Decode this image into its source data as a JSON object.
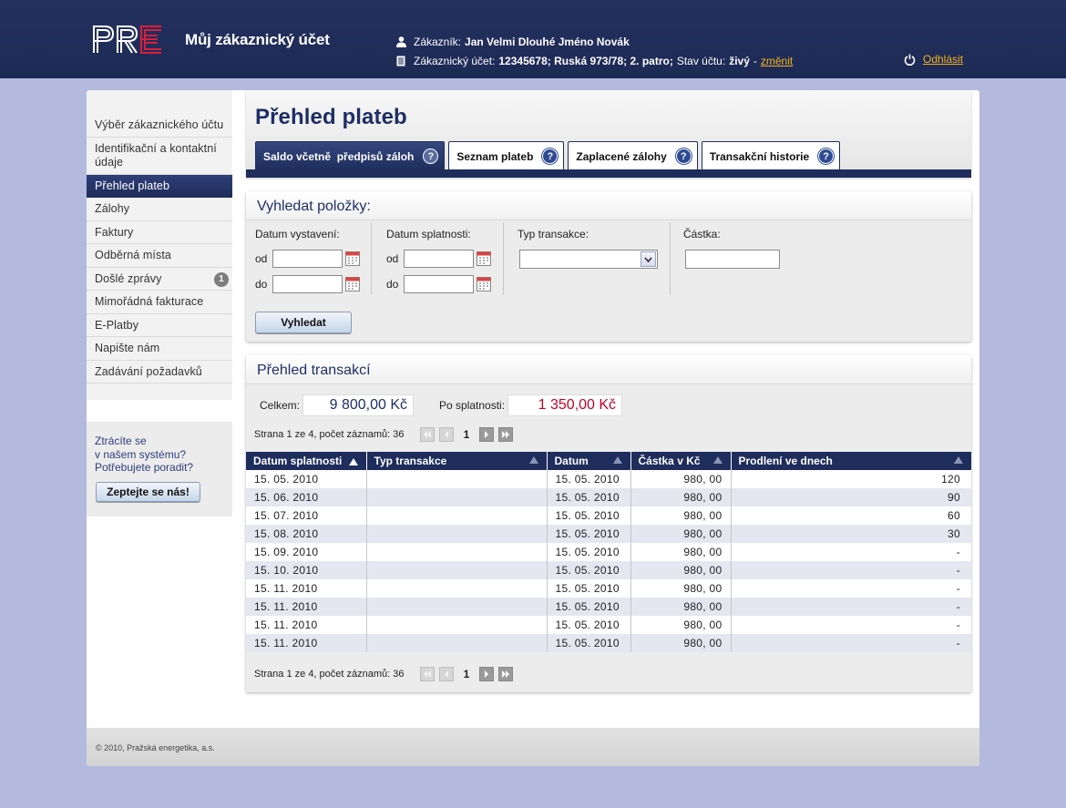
{
  "header": {
    "logo": "PRE",
    "app_title": "Můj zákaznický účet",
    "customer_label": "Zákazník:",
    "customer_name": "Jan Velmi Dlouhé Jméno Novák",
    "account_label": "Zákaznický účet:",
    "account_value": "12345678; Ruská 973/78; 2. patro;",
    "status_label": "Stav účtu:",
    "status_value": "živý",
    "status_sep": "-",
    "change_link": "změnit",
    "logout": "Odhlásit",
    "accent_color": "#f4b21c"
  },
  "sidebar": {
    "items": [
      {
        "label": "Výběr zákaznického účtu"
      },
      {
        "label": "Identifikační a kontaktní údaje"
      },
      {
        "label": "Přehled plateb",
        "active": true
      },
      {
        "label": "Zálohy"
      },
      {
        "label": "Faktury"
      },
      {
        "label": "Odběrná místa"
      },
      {
        "label": "Došlé zprávy",
        "badge": "1"
      },
      {
        "label": "Mimořádná fakturace"
      },
      {
        "label": "E-Platby"
      },
      {
        "label": "Napište nám"
      },
      {
        "label": "Zadávání požadavků"
      }
    ],
    "help_line1": "Ztrácíte se",
    "help_line2": "v našem systému?",
    "help_line3": "Potřebujete poradit?",
    "help_button": "Zeptejte se nás!"
  },
  "main": {
    "title": "Přehled plateb",
    "tabs": [
      {
        "label": "Saldo včetně  předpisů záloh",
        "active": true
      },
      {
        "label": "Seznam plateb"
      },
      {
        "label": "Zaplacené zálohy"
      },
      {
        "label": "Transakční historie"
      }
    ],
    "help_glyph": "?"
  },
  "search": {
    "title": "Vyhledat položky:",
    "issue_date_label": "Datum vystavení:",
    "due_date_label": "Datum splatnosti:",
    "type_label": "Typ transakce:",
    "amount_label": "Částka:",
    "from_label": "od",
    "to_label": "do",
    "type_selected": "",
    "button": "Vyhledat"
  },
  "transactions": {
    "title": "Přehled transakcí",
    "total_label": "Celkem:",
    "total_value": "9 800,00 Kč",
    "overdue_label": "Po splatnosti:",
    "overdue_value": "1 350,00 Kč",
    "total_color": "#1e2f66",
    "overdue_color": "#c4002b",
    "pager_info": "Strana 1 ze 4, počet záznamů: 36",
    "current_page": "1",
    "columns": [
      "Datum splatnosti",
      "Typ transakce",
      "Datum",
      "Částka v Kč",
      "Prodlení ve dnech"
    ],
    "rows": [
      [
        "15. 05. 2010",
        "",
        "15. 05. 2010",
        "980, 00",
        "120"
      ],
      [
        "15. 06. 2010",
        "",
        "15. 05. 2010",
        "980, 00",
        "90"
      ],
      [
        "15. 07. 2010",
        "",
        "15. 05. 2010",
        "980, 00",
        "60"
      ],
      [
        "15. 08. 2010",
        "",
        "15. 05. 2010",
        "980, 00",
        "30"
      ],
      [
        "15. 09. 2010",
        "",
        "15. 05. 2010",
        "980, 00",
        "-"
      ],
      [
        "15. 10. 2010",
        "",
        "15. 05. 2010",
        "980, 00",
        "-"
      ],
      [
        "15. 11. 2010",
        "",
        "15. 05. 2010",
        "980, 00",
        "-"
      ],
      [
        "15. 11. 2010",
        "",
        "15. 05. 2010",
        "980, 00",
        "-"
      ],
      [
        "15. 11. 2010",
        "",
        "15. 05. 2010",
        "980, 00",
        "-"
      ],
      [
        "15. 11. 2010",
        "",
        "15. 05. 2010",
        "980, 00",
        "-"
      ]
    ]
  },
  "footer": {
    "copyright": "© 2010, Pražská energetika, a.s."
  }
}
